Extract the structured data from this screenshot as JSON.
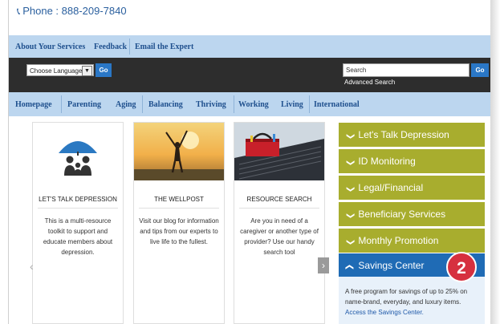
{
  "header": {
    "phone_text": "Phone : 888-209-7840"
  },
  "top_nav": {
    "items": [
      "About Your Services",
      "Feedback",
      "Email the Expert"
    ]
  },
  "toolbar": {
    "language_label": "Choose Language",
    "go_label": "Go",
    "search_value": "Search",
    "search_go_label": "Go",
    "advanced_search": "Advanced Search"
  },
  "main_nav": {
    "items": [
      "Homepage",
      "Parenting",
      "Aging",
      "Balancing",
      "Thriving",
      "Working",
      "Living",
      "International"
    ]
  },
  "cards": [
    {
      "title": "LET'S TALK DEPRESSION",
      "text": "This is a multi-resource toolkit to support and educate members about depression."
    },
    {
      "title": "THE WELLPOST",
      "text": "Visit our blog for information and tips from our experts to live life to the fullest."
    },
    {
      "title": "RESOURCE SEARCH",
      "text": "Are you in need of a caregiver or another type of provider? Use our handy search tool"
    }
  ],
  "accordion": {
    "items": [
      "Let's Talk Depression",
      "ID Monitoring",
      "Legal/Financial",
      "Beneficiary Services",
      "Monthly Promotion",
      "Savings Center"
    ],
    "open_text": "A free program for savings of up to 25% on name-brand, everyday, and luxury items.",
    "open_link": "Access the Savings Center."
  },
  "badge": {
    "number": "2"
  },
  "colors": {
    "nav_blue": "#bcd6ef",
    "olive": "#a8ad2e",
    "open_blue": "#1f6bb5",
    "badge_red": "#d6303f"
  }
}
